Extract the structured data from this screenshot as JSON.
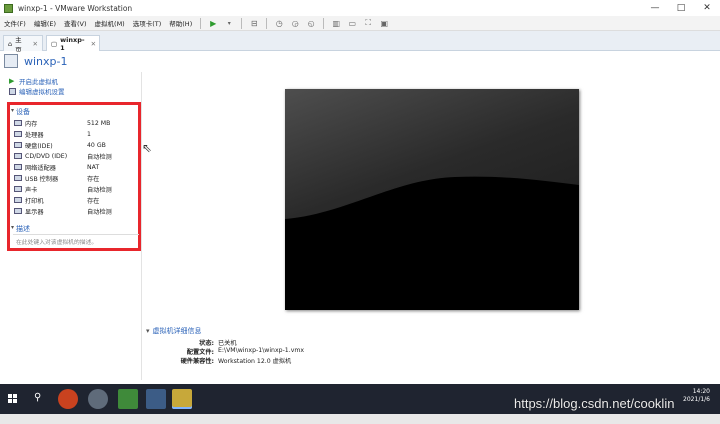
{
  "window": {
    "title": "winxp-1 - VMware Workstation",
    "minimize": "—",
    "maximize": "□",
    "close": "✕"
  },
  "menu": [
    "文件(F)",
    "编辑(E)",
    "查看(V)",
    "虚拟机(M)",
    "选项卡(T)",
    "帮助(H)"
  ],
  "tabs": [
    {
      "label": "主页",
      "active": false
    },
    {
      "label": "winxp-1",
      "active": true
    }
  ],
  "vm": {
    "name": "winxp-1"
  },
  "actions": [
    {
      "label": "开启此虚拟机",
      "icon": "play-icon"
    },
    {
      "label": "编辑虚拟机设置",
      "icon": "settings-icon"
    }
  ],
  "devices": {
    "title": "设备",
    "items": [
      {
        "name": "内存",
        "value": "512 MB",
        "icon": "memory-icon"
      },
      {
        "name": "处理器",
        "value": "1",
        "icon": "processor-icon"
      },
      {
        "name": "硬盘(IDE)",
        "value": "40 GB",
        "icon": "harddisk-icon"
      },
      {
        "name": "CD/DVD (IDE)",
        "value": "自动检测",
        "icon": "cdrom-icon"
      },
      {
        "name": "网络适配器",
        "value": "NAT",
        "icon": "network-icon"
      },
      {
        "name": "USB 控制器",
        "value": "存在",
        "icon": "usb-icon"
      },
      {
        "name": "声卡",
        "value": "自动检测",
        "icon": "sound-icon"
      },
      {
        "name": "打印机",
        "value": "存在",
        "icon": "printer-icon"
      },
      {
        "name": "显示器",
        "value": "自动检测",
        "icon": "display-icon"
      }
    ]
  },
  "description": {
    "title": "描述",
    "placeholder": "在此处键入对该虚拟机的描述。"
  },
  "details": {
    "title": "虚拟机详细信息",
    "rows": [
      {
        "key": "状态:",
        "value": "已关机"
      },
      {
        "key": "配置文件:",
        "value": "E:\\VM\\winxp-1\\winxp-1.vmx"
      },
      {
        "key": "硬件兼容性:",
        "value": "Workstation 12.0 虚拟机"
      }
    ]
  },
  "taskbar": {
    "time": "14:20",
    "date": "2021/1/6"
  },
  "watermark": "https://blog.csdn.net/cooklin",
  "colors": {
    "highlight_box": "#e8262c",
    "link": "#2a62b8",
    "taskbar": "#1f2430"
  }
}
